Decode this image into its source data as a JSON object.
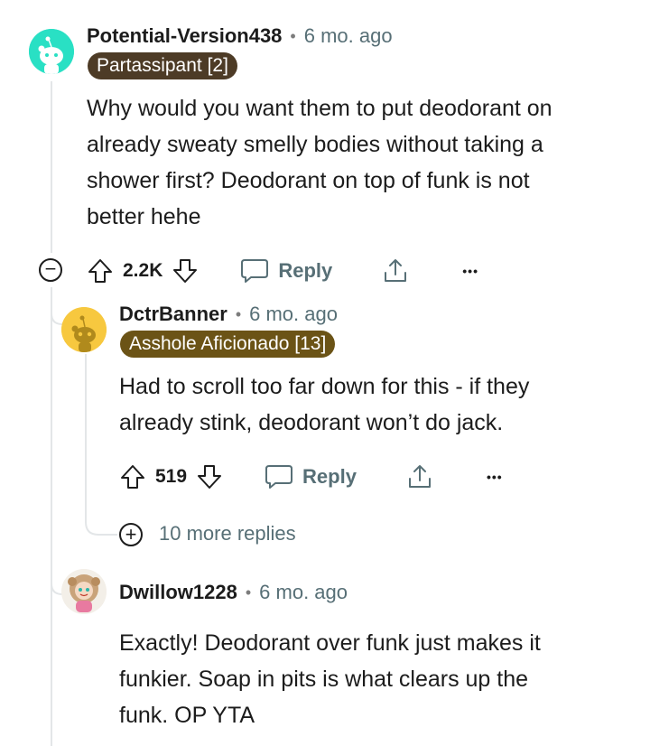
{
  "colors": {
    "flair_brown": "#4d3b26",
    "flair_gold": "#6b5316",
    "muted_text": "#576f76",
    "thread_line": "#e3e6e8",
    "avatar_teal": "#29e0c4",
    "avatar_yellow": "#f7c83f"
  },
  "comments": [
    {
      "username": "Potential-Version438",
      "separator": "•",
      "time": "6 mo. ago",
      "flair": "Partassipant [2]",
      "body": [
        "Why would you want them to put deodorant on",
        "already sweaty smelly bodies without taking a",
        "shower first? Deodorant on top of funk is not",
        "better hehe"
      ],
      "votes": "2.2K",
      "reply_label": "Reply",
      "more_label": "•••",
      "collapse_label": "−"
    },
    {
      "username": "DctrBanner",
      "separator": "•",
      "time": "6 mo. ago",
      "flair": "Asshole Aficionado [13]",
      "body": [
        "Had to scroll too far down for this - if they",
        "already stink, deodorant won’t do jack."
      ],
      "votes": "519",
      "reply_label": "Reply",
      "more_label": "•••"
    },
    {
      "username": "Dwillow1228",
      "separator": "•",
      "time": "6 mo. ago",
      "body": [
        "Exactly! Deodorant over funk just makes it",
        "funkier. Soap in pits is what clears up the",
        "funk. OP YTA"
      ]
    }
  ],
  "more_replies": {
    "expand_label": "+",
    "text": "10 more replies"
  },
  "icons": {
    "upvote": "arrow-up-icon",
    "downvote": "arrow-down-icon",
    "reply": "speech-bubble-icon",
    "share": "share-icon",
    "collapse": "minus-circle-icon",
    "expand": "plus-circle-icon"
  }
}
